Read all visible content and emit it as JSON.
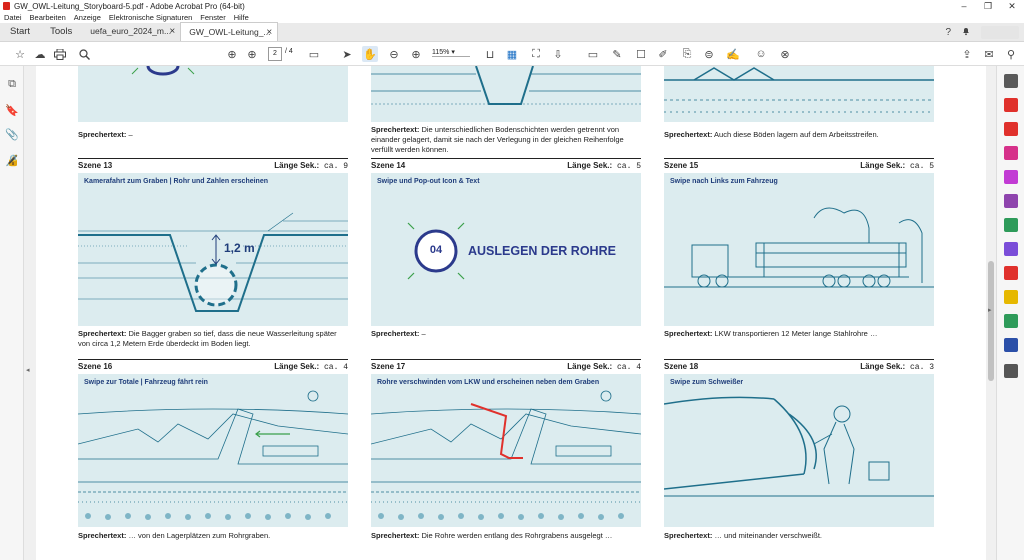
{
  "window": {
    "title": "GW_OWL-Leitung_Storyboard-5.pdf - Adobe Acrobat Pro (64-bit)",
    "controls": [
      "–",
      "❐",
      "✕"
    ]
  },
  "menu": [
    "Datei",
    "Bearbeiten",
    "Anzeige",
    "Elektronische Signaturen",
    "Fenster",
    "Hilfe"
  ],
  "tabs": {
    "start": "Start",
    "tools": "Tools",
    "doc1": "uefa_euro_2024_m...",
    "doc2": "GW_OWL-Leitung_...",
    "close": "×"
  },
  "toolbar": {
    "page_current": "2",
    "page_total": "/ 4",
    "zoom": "115%"
  },
  "colors": {
    "accent": "#1f6f8b",
    "panel_bg": "#dcecef",
    "title": "#1f3d7a",
    "pipe": "#e0312c"
  },
  "top_row": {
    "sp1_label": "Sprechertext:",
    "sp1_text": " –",
    "sp2_label": "Sprechertext:",
    "sp2_text": " Die unterschiedlichen Bodenschichten werden getrennt von einander gelagert, damit sie nach der Verlegung in der gleichen Reihenfolge verfüllt werden können.",
    "sp3_label": "Sprechertext:",
    "sp3_text": " Auch diese Böden lagern auf dem Arbeitsstreifen."
  },
  "scenes": [
    {
      "title": "Szene 13",
      "length_label": "Länge Sek.:",
      "length_value": " ca. 9",
      "caption": "Kamerafahrt zum Graben | Rohr und Zahlen erscheinen",
      "measure": "1,2 m",
      "sp_label": "Sprechertext:",
      "sp_text": " Die Bagger graben so tief, dass die neue Wasserleitung später von circa 1,2 Metern Erde überdeckt im Boden liegt."
    },
    {
      "title": "Szene 14",
      "length_label": "Länge Sek.:",
      "length_value": " ca. 5",
      "caption": "Swipe und Pop-out Icon & Text",
      "badge": "04",
      "headline": "AUSLEGEN DER ROHRE",
      "sp_label": "Sprechertext:",
      "sp_text": " –"
    },
    {
      "title": "Szene 15",
      "length_label": "Länge Sek.:",
      "length_value": " ca. 5",
      "caption": "Swipe nach Links zum Fahrzeug",
      "sp_label": "Sprechertext:",
      "sp_text": " LKW transportieren 12 Meter lange Stahlrohre …"
    },
    {
      "title": "Szene 16",
      "length_label": "Länge Sek.:",
      "length_value": " ca. 4",
      "caption": "Swipe zur Totale | Fahrzeug fährt rein",
      "sp_label": "Sprechertext:",
      "sp_text": " … von den Lagerplätzen zum Rohrgraben."
    },
    {
      "title": "Szene 17",
      "length_label": "Länge Sek.:",
      "length_value": " ca. 4",
      "caption": "Rohre verschwinden vom LKW und erscheinen neben dem Graben",
      "sp_label": "Sprechertext:",
      "sp_text": " Die Rohre werden entlang des Rohrgrabens ausgelegt …"
    },
    {
      "title": "Szene 18",
      "length_label": "Länge Sek.:",
      "length_value": " ca. 3",
      "caption": "Swipe zum Schweißer",
      "sp_label": "Sprechertext:",
      "sp_text": " … und miteinander verschweißt."
    }
  ]
}
